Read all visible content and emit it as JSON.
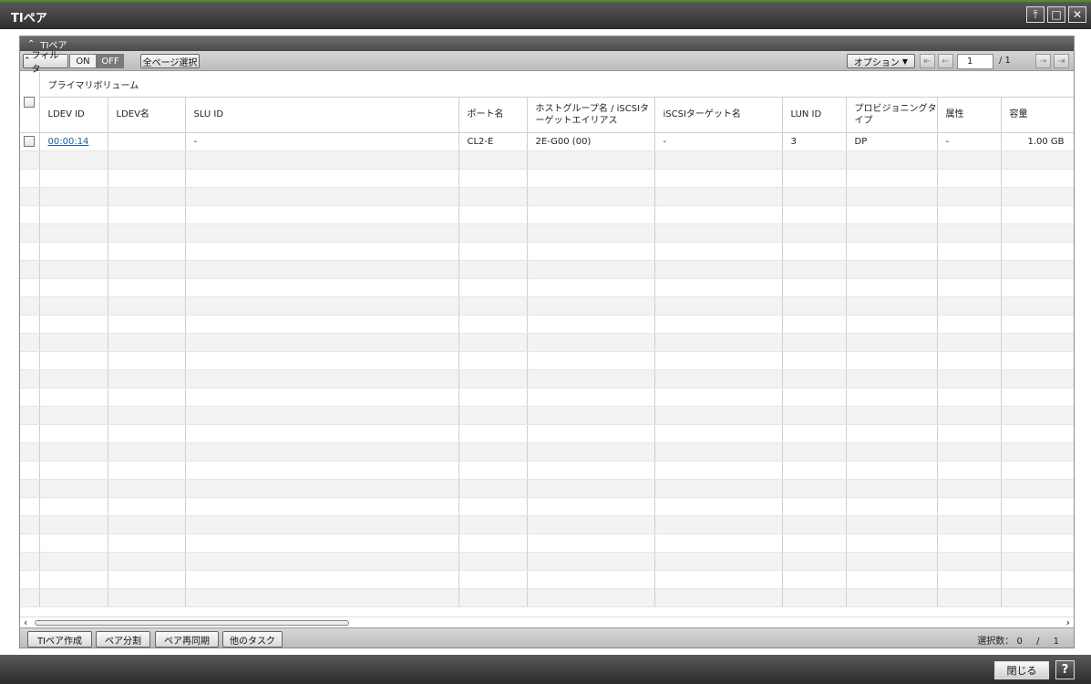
{
  "window": {
    "title": "TIペア",
    "pin_icon": "pin-top-icon",
    "maximize_icon": "maximize-icon",
    "close_icon": "close-icon"
  },
  "panel": {
    "title": "TIペア",
    "collapse_icon": "double-chevron-up-icon"
  },
  "toolbar": {
    "filter_label": "フィルタ",
    "on_label": "ON",
    "off_label": "OFF",
    "select_all_pages_label": "全ページ選択",
    "options_label": "オプション",
    "current_page": "1",
    "total_pages": "/ 1"
  },
  "table": {
    "group_header": "プライマリボリューム",
    "columns": [
      "LDEV ID",
      "LDEV名",
      "SLU ID",
      "ポート名",
      "ホストグループ名 / iSCSIターゲットエイリアス",
      "iSCSIターゲット名",
      "LUN ID",
      "プロビジョニングタイプ",
      "属性",
      "容量"
    ],
    "rows": [
      [
        "00:00:14",
        "",
        "-",
        "CL2-E",
        "2E-G00 (00)",
        "-",
        "3",
        "DP",
        "-",
        "1.00 GB"
      ]
    ]
  },
  "footer": {
    "create_label": "TIペア作成",
    "split_label": "ペア分割",
    "resync_label": "ペア再同期",
    "other_tasks_label": "他のタスク",
    "selection_label": "選択数：",
    "selected_count": "0",
    "separator": "/",
    "total_count": "1"
  },
  "dialog": {
    "close_label": "閉じる",
    "help_label": "?"
  }
}
